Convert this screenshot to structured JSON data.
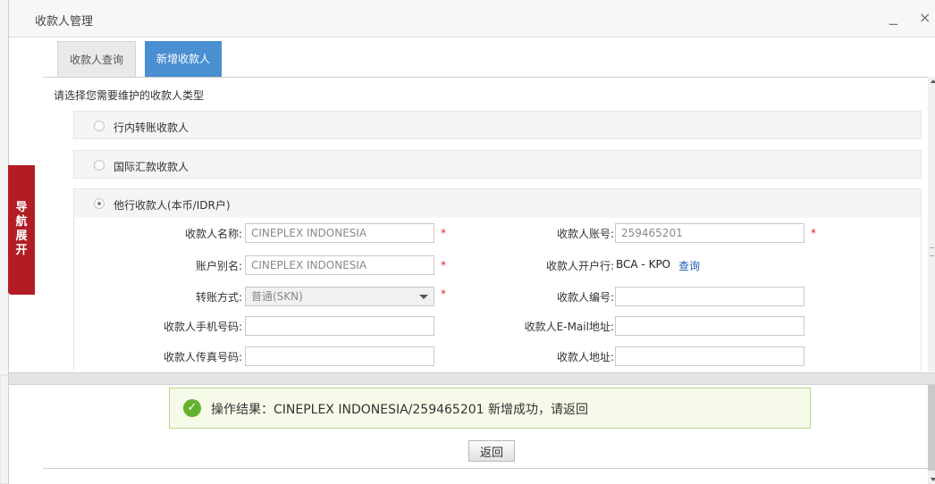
{
  "window": {
    "title": "收款人管理",
    "minimize_glyph": "_",
    "close_glyph": "×"
  },
  "tabs": [
    {
      "label": "收款人查询",
      "active": false
    },
    {
      "label": "新增收款人",
      "active": true
    }
  ],
  "form": {
    "prompt": "请选择您需要维护的收款人类型",
    "options": [
      {
        "label": "行内转账收款人",
        "checked": false
      },
      {
        "label": "国际汇款收款人",
        "checked": false
      },
      {
        "label": "他行收款人(本币/IDR户)",
        "checked": true
      }
    ],
    "fields": {
      "payee_name_label": "收款人名称:",
      "payee_name_value": "CINEPLEX INDONESIA",
      "account_no_label": "收款人账号:",
      "account_no_value": "259465201",
      "alias_label": "账户别名:",
      "alias_value": "CINEPLEX INDONESIA",
      "bank_label": "收款人开户行:",
      "bank_value": "BCA - KPO",
      "bank_query_link": "查询",
      "transfer_method_label": "转账方式:",
      "transfer_method_value": "普通(SKN)",
      "payee_code_label": "收款人编号:",
      "payee_code_value": "",
      "mobile_label": "收款人手机号码:",
      "mobile_value": "",
      "email_label": "收款人E-Mail地址:",
      "email_value": "",
      "fax_label": "收款人传真号码:",
      "fax_value": "",
      "address_label": "收款人地址:",
      "address_value": ""
    },
    "required_mark": "*"
  },
  "result": {
    "message": "操作结果：CINEPLEX INDONESIA/259465201   新增成功，请返回",
    "icon": "check-circle-icon",
    "back_label": "返回"
  },
  "nav": {
    "label": "导航展开"
  },
  "colors": {
    "tab_active": "#4a8fd1",
    "nav_red": "#b21d24",
    "success_green": "#63b22e",
    "required_red": "#d9232d",
    "link_blue": "#1a5fb4"
  }
}
